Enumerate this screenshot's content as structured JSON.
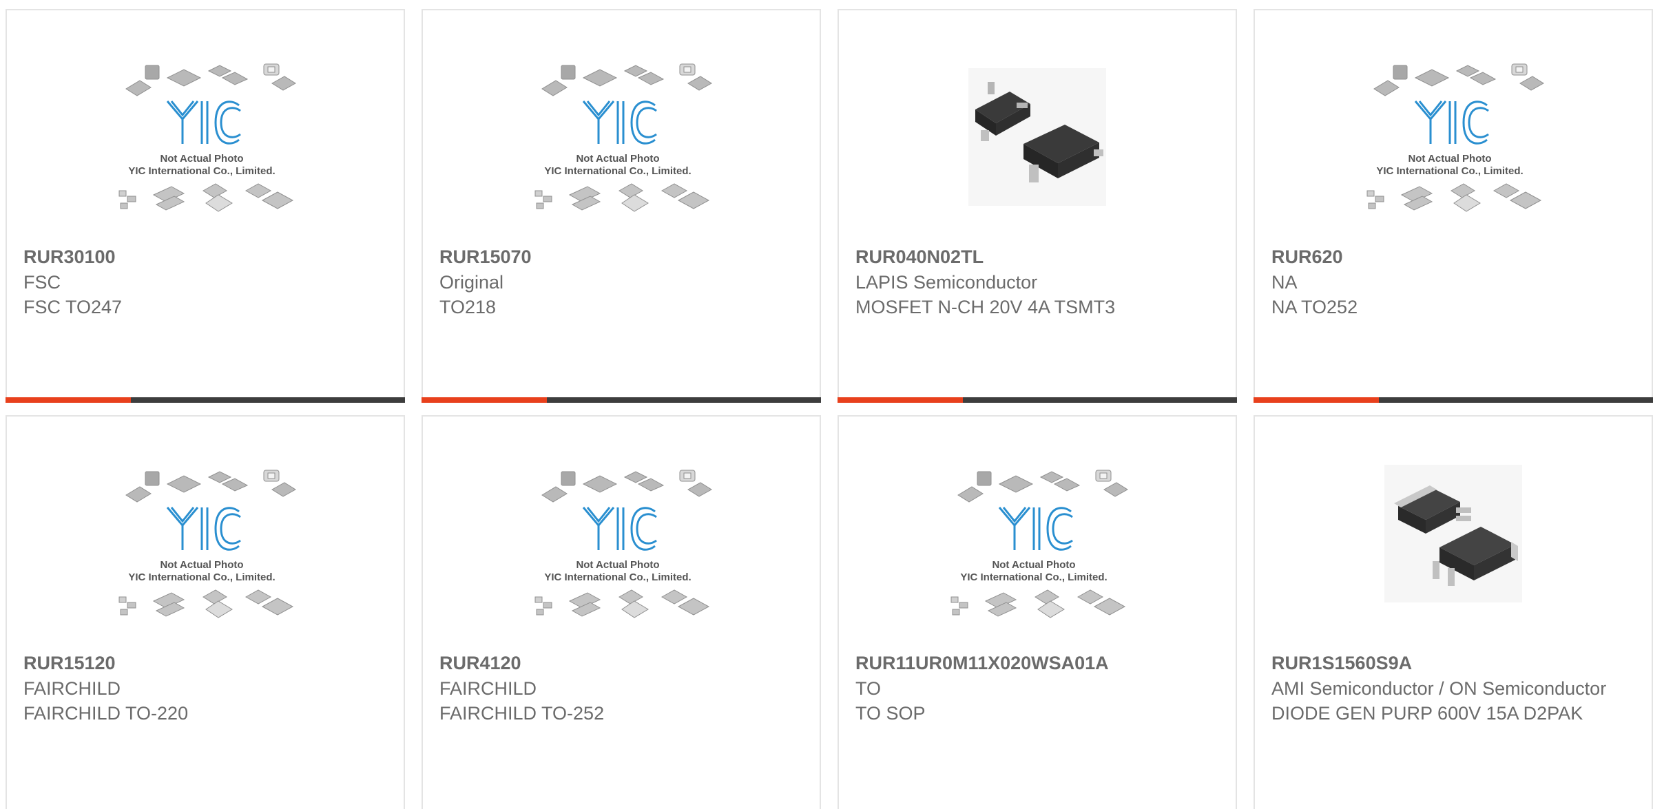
{
  "placeholder": {
    "line1": "Not Actual Photo",
    "line2": "YIC International Co., Limited.",
    "logo": "YIC"
  },
  "colors": {
    "accent": "#e8401c",
    "bar": "#3d3d3d",
    "logo": "#2a8fd0",
    "text": "#6b6b6b"
  },
  "products": [
    {
      "part": "RUR30100",
      "maker": "FSC",
      "desc": "FSC TO247",
      "image": "yic-placeholder"
    },
    {
      "part": "RUR15070",
      "maker": "Original",
      "desc": "TO218",
      "image": "yic-placeholder"
    },
    {
      "part": "RUR040N02TL",
      "maker": "LAPIS Semiconductor",
      "desc": "MOSFET N-CH 20V 4A TSMT3",
      "image": "sot-package-photo"
    },
    {
      "part": "RUR620",
      "maker": "NA",
      "desc": "NA TO252",
      "image": "yic-placeholder"
    },
    {
      "part": "RUR15120",
      "maker": "FAIRCHILD",
      "desc": "FAIRCHILD TO-220",
      "image": "yic-placeholder"
    },
    {
      "part": "RUR4120",
      "maker": "FAIRCHILD",
      "desc": "FAIRCHILD TO-252",
      "image": "yic-placeholder"
    },
    {
      "part": "RUR11UR0M11X020WSA01A",
      "maker": "TO",
      "desc": "TO SOP",
      "image": "yic-placeholder"
    },
    {
      "part": "RUR1S1560S9A",
      "maker": "AMI Semiconductor / ON Semiconductor",
      "desc": "DIODE GEN PURP 600V 15A D2PAK",
      "image": "d2pak-package-photo"
    }
  ]
}
